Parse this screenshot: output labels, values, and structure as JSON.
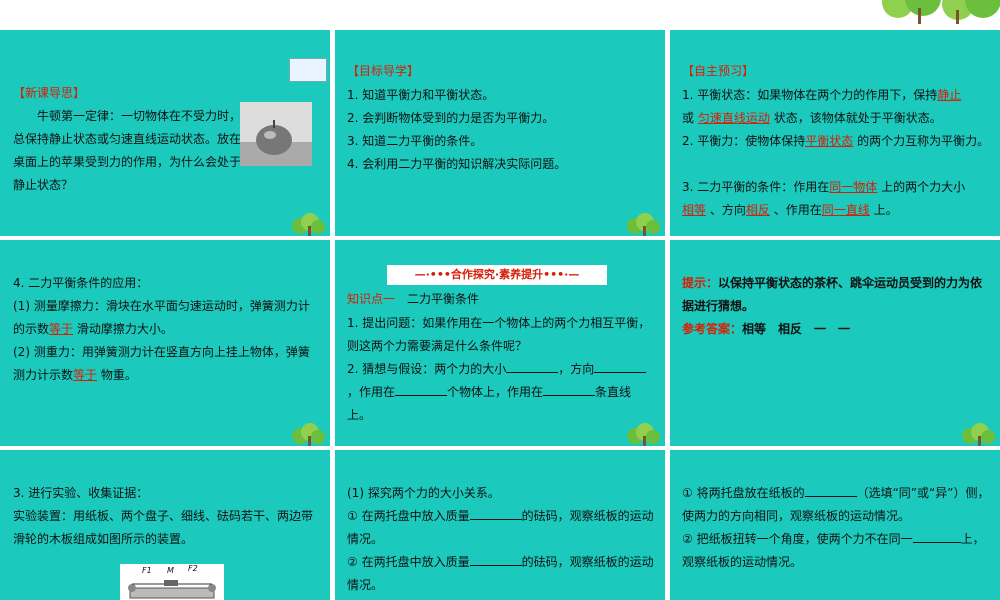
{
  "p1": {
    "heading": "【新课导思】",
    "body": "牛顿第一定律：一切物体在不受力时，总保持静止状态或匀速直线运动状态。放在桌面上的苹果受到力的作用，为什么会处于静止状态？"
  },
  "p2": {
    "heading": "【目标导学】",
    "items": [
      "1. 知道平衡力和平衡状态。",
      "2. 会判断物体受到的力是否为平衡力。",
      "3. 知道二力平衡的条件。",
      "4. 会利用二力平衡的知识解决实际问题。"
    ]
  },
  "p3": {
    "heading": "【自主预习】",
    "l1a": "1. 平衡状态：如果物体在两个力的作用下，保持",
    "f1": "静止",
    "l1b": "或",
    "f2": "匀速直线运动",
    "l1c": "状态，该物体就处于平衡状态。",
    "l2a": "2. 平衡力：使物体保持",
    "f3": "平衡状态",
    "l2b": "的两个力互称为平衡力。",
    "l3a": "3. 二力平衡的条件：作用在",
    "f4": "同一物体",
    "l3b": "上的两个力大小",
    "f5": "相等",
    "l3c": "、方向",
    "f6": "相反",
    "l3d": "、作用在",
    "f7": "同一直线",
    "l3e": "上。"
  },
  "p4": {
    "l1": "4. 二力平衡条件的应用：",
    "l2a": "(1) 测量摩擦力：滑块在水平面匀速运动时，弹簧测力计的示数",
    "f1": "等于",
    "l2b": "滑动摩擦力大小。",
    "l3a": "(2) 测重力：用弹簧测力计在竖直方向上挂上物体，弹簧测力计示数",
    "f2": "等于",
    "l3b": "物重。"
  },
  "p5": {
    "banner": "合作探究·素养提升",
    "kp_label": "知识点一",
    "kp_title": "二力平衡条件",
    "l1": "1. 提出问题：如果作用在一个物体上的两个力相互平衡，则这两个力需要满足什么条件呢？",
    "l2a": "2. 猜想与假设：两个力的大小",
    "l2b": "，方向",
    "l2c": "，作用在",
    "l2d": "个物体上，作用在",
    "l2e": "条直线上。"
  },
  "p6": {
    "hint_label": "提示：",
    "hint": "以保持平衡状态的茶杯、跳伞运动员受到的力为依据进行猜想。",
    "ans_label": "参考答案：",
    "ans": "相等　相反　一　一"
  },
  "p7": {
    "l1": "3. 进行实验、收集证据：",
    "l2": "实验装置：用纸板、两个盘子、细线、砝码若干、两边带滑轮的木板组成如图所示的装置。",
    "fig_f1": "F1",
    "fig_m": "M",
    "fig_f2": "F2"
  },
  "p8": {
    "l1": "(1) 探究两个力的大小关系。",
    "l2a": "① 在两托盘中放入质量",
    "l2b": "的砝码，观察纸板的运动情况。",
    "l3a": "② 在两托盘中放入质量",
    "l3b": "的砝码，观察纸板的运动情况。"
  },
  "p9": {
    "l1a": "① 将两托盘放在纸板的",
    "l1b": "（选填“同”或“异”）侧，使两力的方向相同，观察纸板的运动情况。",
    "l2a": "② 把纸板扭转一个角度，使两个力不在同一",
    "l2b": "上，观察纸板的运动情况。"
  }
}
